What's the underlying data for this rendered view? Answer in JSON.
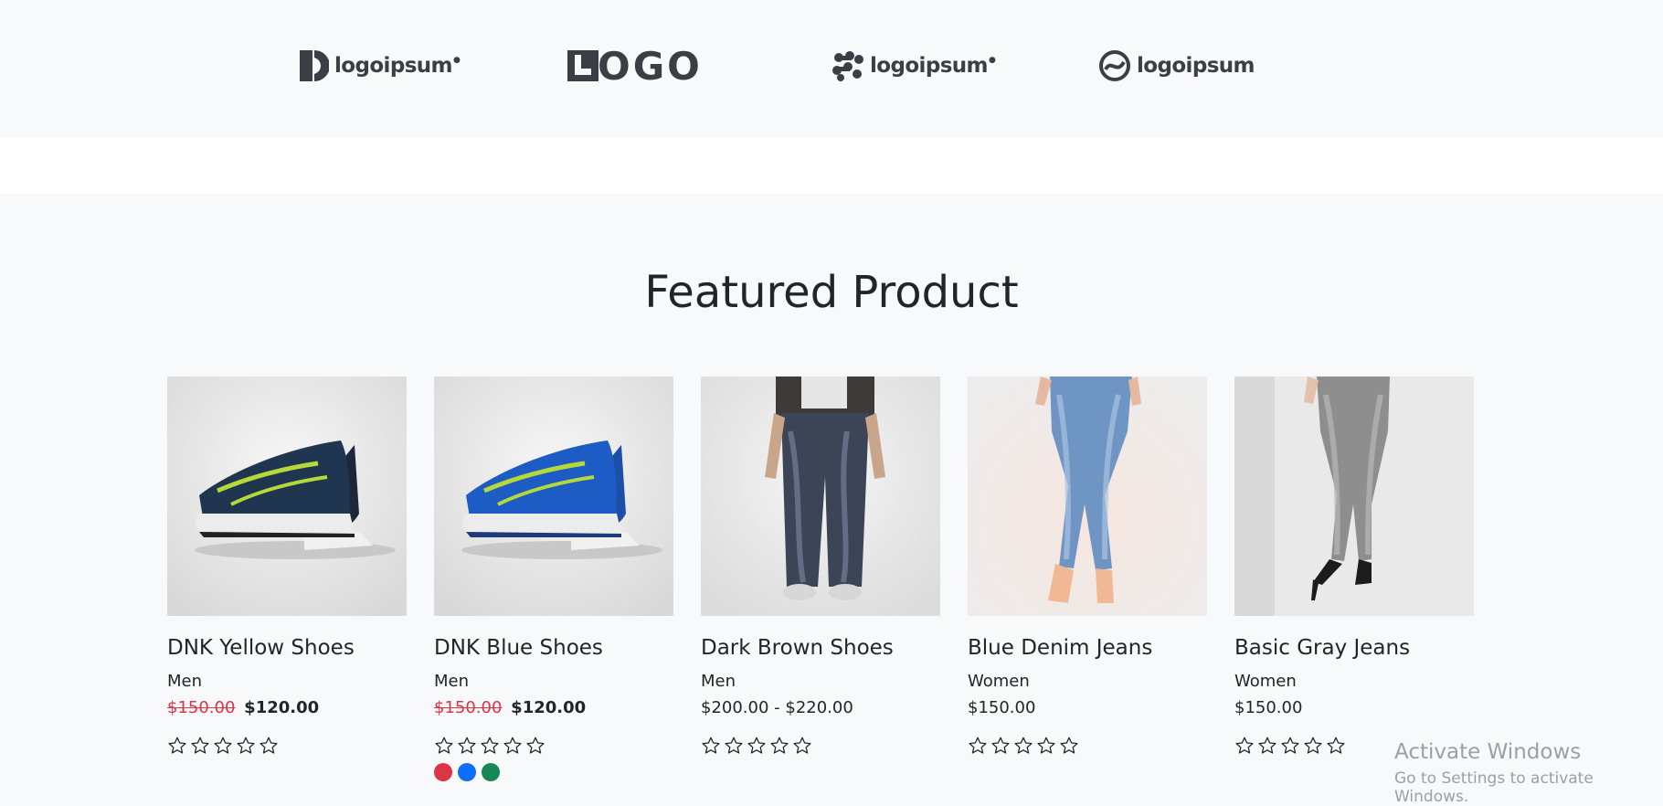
{
  "brand_logos": [
    {
      "name": "logo-1",
      "text": "logoipsum",
      "mark": "half-circle"
    },
    {
      "name": "logo-2",
      "text": "LOGO",
      "mark": "block"
    },
    {
      "name": "logo-3",
      "text": "logoipsum",
      "mark": "molecule"
    },
    {
      "name": "logo-4",
      "text": "logoipsum",
      "mark": "circle-stripes"
    }
  ],
  "featured": {
    "title": "Featured Product"
  },
  "products": [
    {
      "title": "DNK Yellow Shoes",
      "category": "Men",
      "old_price": "$150.00",
      "price": "$120.00",
      "rating": 0,
      "image": "shoes-yellow"
    },
    {
      "title": "DNK Blue Shoes",
      "category": "Men",
      "old_price": "$150.00",
      "price": "$120.00",
      "rating": 0,
      "image": "shoes-blue",
      "swatches": [
        "#dc3545",
        "#0d6efd",
        "#198754"
      ]
    },
    {
      "title": "Dark Brown Shoes",
      "category": "Men",
      "price_range": "$200.00 - $220.00",
      "rating": 0,
      "image": "jeans-dark"
    },
    {
      "title": "Blue Denim Jeans",
      "category": "Women",
      "price": "$150.00",
      "rating": 0,
      "image": "jeans-blue"
    },
    {
      "title": "Basic Gray Jeans",
      "category": "Women",
      "price": "$150.00",
      "rating": 0,
      "image": "jeans-gray"
    }
  ],
  "os_watermark": {
    "title": "Activate Windows",
    "subtitle": "Go to Settings to activate Windows."
  },
  "colors": {
    "page_bg": "#f8f9fa",
    "text": "#212529",
    "sale_red": "#dc3545"
  }
}
